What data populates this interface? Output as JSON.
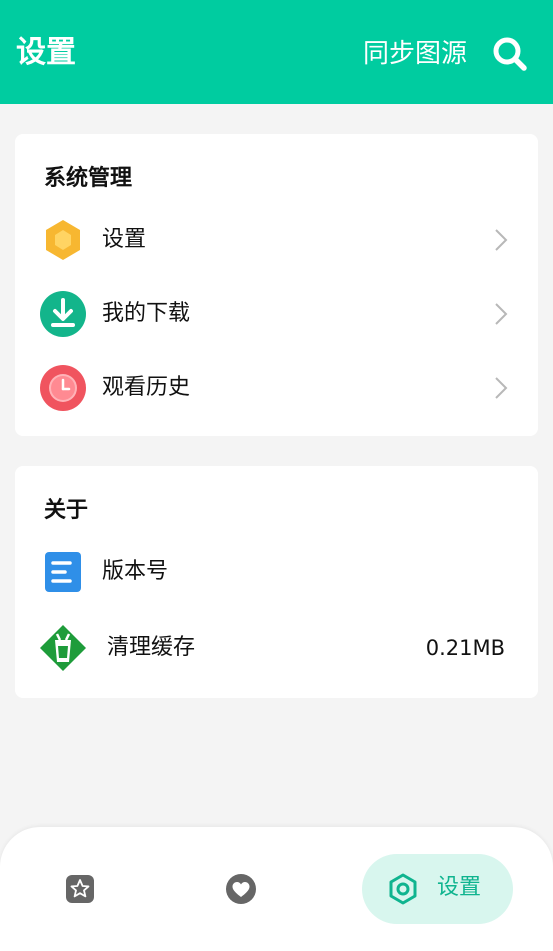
{
  "appbar": {
    "title": "设置",
    "sync_label": "同步图源",
    "search_icon": "search-icon",
    "background": "#00cca0"
  },
  "system_card": {
    "title": "系统管理",
    "items": [
      {
        "label": "设置",
        "icon": "settings-hexagon-icon",
        "color": "#f7b731"
      },
      {
        "label": "我的下载",
        "icon": "download-icon",
        "color": "#13b58b"
      },
      {
        "label": "观看历史",
        "icon": "clock-icon",
        "color": "#f0545f"
      }
    ]
  },
  "about_card": {
    "title": "关于",
    "items": [
      {
        "label": "版本号",
        "icon": "document-icon",
        "color": "#2f8fe8"
      },
      {
        "label": "清理缓存",
        "value": "0.21MB",
        "icon": "trash-bin-icon",
        "color": "#1e9c3a"
      }
    ]
  },
  "bottom_nav": {
    "items": [
      {
        "icon": "star-icon"
      },
      {
        "icon": "heart-icon"
      },
      {
        "icon": "gear-icon",
        "label": "设置",
        "active": true
      }
    ],
    "active_color": "#0fb48f",
    "active_background": "#d8f6ee"
  }
}
